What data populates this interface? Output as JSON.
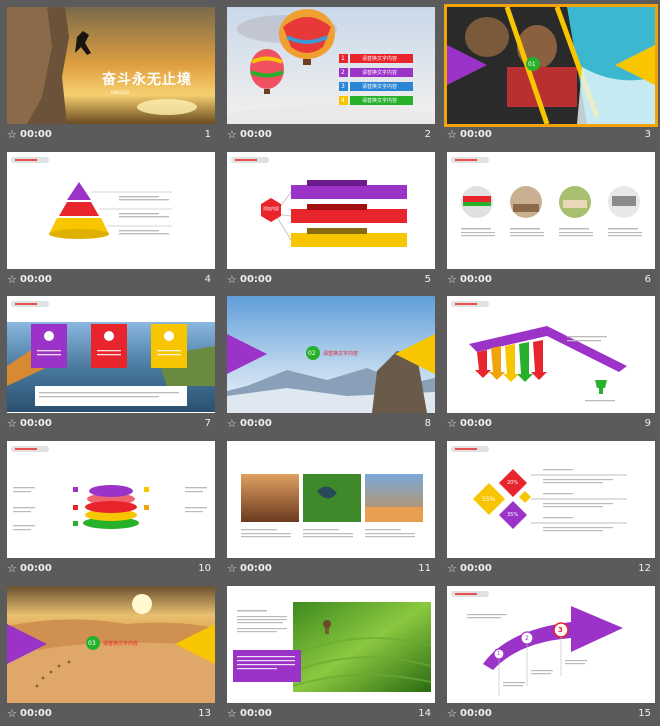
{
  "slides": [
    {
      "number": "1",
      "time": "00:00",
      "title": "奋斗永无止境",
      "subtitle": "ENDLESS"
    },
    {
      "number": "2",
      "time": "00:00",
      "items": [
        {
          "n": "1",
          "label": "请替换文字内容",
          "color": "#e8242d"
        },
        {
          "n": "2",
          "label": "请替换文字内容",
          "color": "#9c33c9"
        },
        {
          "n": "3",
          "label": "请替换文字内容",
          "color": "#2b86d6"
        },
        {
          "n": "4",
          "label": "请替换文字内容",
          "color": "#27b12b"
        }
      ]
    },
    {
      "number": "3",
      "time": "00:00",
      "section": "01"
    },
    {
      "number": "4",
      "time": "00:00"
    },
    {
      "number": "5",
      "time": "00:00",
      "center": "添加内容"
    },
    {
      "number": "6",
      "time": "00:00"
    },
    {
      "number": "7",
      "time": "00:00"
    },
    {
      "number": "8",
      "time": "00:00",
      "section": "02",
      "label": "请替换文字内容"
    },
    {
      "number": "9",
      "time": "00:00"
    },
    {
      "number": "10",
      "time": "00:00"
    },
    {
      "number": "11",
      "time": "00:00"
    },
    {
      "number": "12",
      "time": "00:00",
      "values": [
        "20%",
        "55%",
        "35%"
      ]
    },
    {
      "number": "13",
      "time": "00:00",
      "section": "03",
      "label": "请替换文字内容"
    },
    {
      "number": "14",
      "time": "00:00"
    },
    {
      "number": "15",
      "time": "00:00",
      "steps": [
        "1",
        "2",
        "3"
      ]
    }
  ],
  "colors": {
    "purple": "#9c33c9",
    "red": "#e8242d",
    "yellow": "#f7c600",
    "green": "#27b12b",
    "orange": "#f0a30a"
  }
}
